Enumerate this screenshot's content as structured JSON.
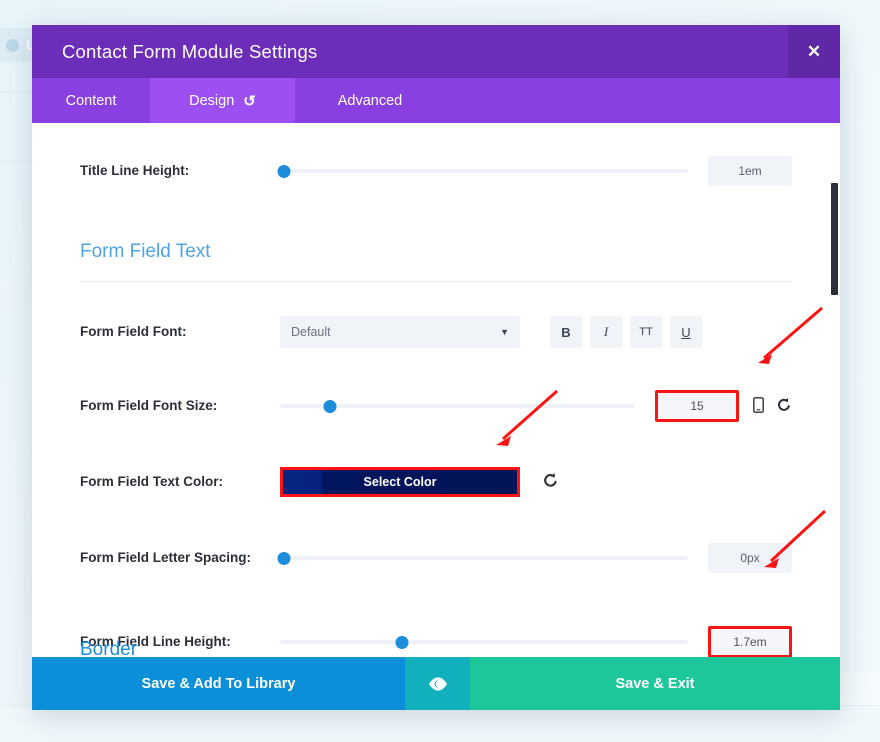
{
  "background": {
    "toolbar_text": "Us"
  },
  "modal": {
    "title": "Contact Form Module Settings",
    "close_label": "✕",
    "tabs": [
      {
        "label": "Content",
        "active": false,
        "has_reset": false,
        "reset_glyph": ""
      },
      {
        "label": "Design",
        "active": true,
        "has_reset": true,
        "reset_glyph": "↺"
      },
      {
        "label": "Advanced",
        "active": false,
        "has_reset": false,
        "reset_glyph": ""
      }
    ],
    "rows": [
      {
        "label": "Title Line Height:",
        "type": "slider",
        "handle_pct": 1,
        "value": "1em",
        "highlighted": false
      },
      {
        "label": "Form Field Font:",
        "type": "font",
        "select_value": "Default",
        "caret": "▼",
        "style_buttons": [
          {
            "name": "bold-button",
            "glyph": "B"
          },
          {
            "name": "italic-button",
            "glyph": "I"
          },
          {
            "name": "uppercase-button",
            "glyph": "TT"
          },
          {
            "name": "underline-button",
            "glyph": "U"
          }
        ]
      },
      {
        "label": "Form Field Font Size:",
        "type": "slider",
        "handle_pct": 14,
        "value": "15",
        "highlighted": true,
        "device_icon": "☐",
        "reset_icon": "↺"
      },
      {
        "label": "Form Field Text Color:",
        "type": "color",
        "button_label": "Select Color",
        "color_value": "#011455",
        "reset_icon": "↺"
      },
      {
        "label": "Form Field Letter Spacing:",
        "type": "slider",
        "handle_pct": 1,
        "value": "0px",
        "highlighted": false
      },
      {
        "label": "Form Field Line Height:",
        "type": "slider",
        "handle_pct": 30,
        "value": "1.7em",
        "highlighted": false,
        "value_highlighted": true
      }
    ],
    "section_heading": "Form Field Text",
    "next_section_heading": "Border",
    "footer": {
      "save_library_label": "Save & Add To Library",
      "preview_icon": "eye-icon",
      "save_exit_label": "Save & Exit"
    }
  },
  "colors": {
    "header_purple": "#6c2eb9",
    "tab_purple": "#8a3fe0",
    "tab_active_purple": "#9d4ff2",
    "accent_blue": "#1e8cdb",
    "section_blue": "#4fa3e8",
    "annotation_red": "#fc1414",
    "footer_blue": "#0a8fd8",
    "footer_teal": "#12b0bd",
    "footer_green": "#1dc79b"
  }
}
